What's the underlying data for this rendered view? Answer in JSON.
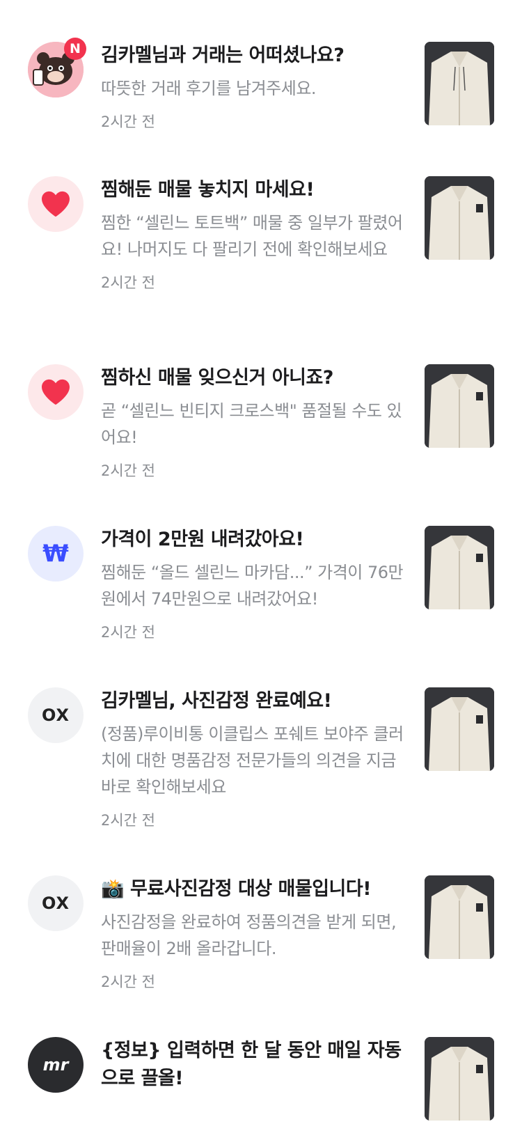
{
  "notifications": [
    {
      "avatar_type": "bear",
      "badge": "N",
      "title": "김카멜님과 거래는 어떠셨나요?",
      "body": "따뜻한 거래 후기를 남겨주세요.",
      "time": "2시간 전",
      "thumb_icon": "jacket-image"
    },
    {
      "avatar_type": "heart",
      "title": "찜해둔 매물 놓치지 마세요!",
      "body": "찜한 “셀린느 토트백” 매물 중 일부가 팔렸어요! 나머지도 다 팔리기 전에 확인해보세요",
      "time": "2시간 전",
      "thumb_icon": "jacket-image"
    },
    {
      "avatar_type": "heart",
      "title": "찜하신 매물 잊으신거 아니죠?",
      "body": "곧 “셀린느 빈티지 크로스백\" 품절될 수도 있어요!",
      "time": "2시간 전",
      "thumb_icon": "jacket-image"
    },
    {
      "avatar_type": "won",
      "avatar_text": "₩",
      "title": "가격이 2만원 내려갔아요!",
      "body": "찜해둔 “올드 셀린느 마카담...” 가격이 76만원에서 74만원으로 내려갔어요!",
      "time": "2시간 전",
      "thumb_icon": "jacket-image"
    },
    {
      "avatar_type": "ox",
      "avatar_text": "OX",
      "title": "김카멜님, 사진감정 완료예요!",
      "body": "(정품)루이비통 이클립스 포쉐트 보야주 클러치에 대한 명품감정 전문가들의 의견을 지금바로 확인해보세요",
      "time": "2시간 전",
      "thumb_icon": "jacket-image"
    },
    {
      "avatar_type": "ox",
      "avatar_text": "OX",
      "title": "📸 무료사진감정 대상 매물입니다!",
      "body": "사진감정을 완료하여 정품의견을 받게 되면, 판매율이 2배 올라갑니다.",
      "time": "2시간 전",
      "thumb_icon": "jacket-image"
    },
    {
      "avatar_type": "mr",
      "avatar_text": "mr",
      "title": "{정보} 입력하면 한 달 동안 매일 자동으로 끌올!",
      "body": "",
      "time": "",
      "thumb_icon": "jacket-image"
    }
  ],
  "colors": {
    "badge": "#f2334e",
    "heart": "#f2334e",
    "won": "#3a4dff",
    "secondary_text": "#8a8d92"
  }
}
